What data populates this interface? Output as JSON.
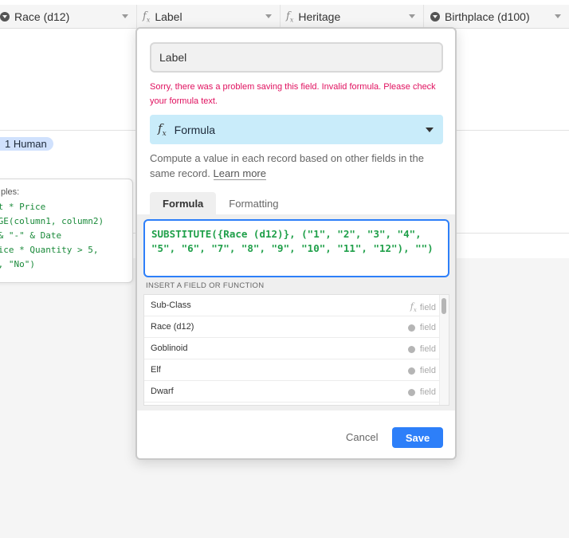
{
  "columns": [
    {
      "label": "Race (d12)",
      "icon": "single-select-icon"
    },
    {
      "label": "Label",
      "icon": "formula-icon"
    },
    {
      "label": "Heritage",
      "icon": "formula-icon"
    },
    {
      "label": "Birthplace (d100)",
      "icon": "single-select-icon"
    }
  ],
  "grid": {
    "tag": "1 Human",
    "examples_title": "ples:",
    "examples_lines": [
      "nt * Price",
      "AGE(column1, column2)",
      " & \"-\" & Date",
      "rice * Quantity > 5,",
      "\", \"No\")"
    ]
  },
  "dialog": {
    "field_name": "Label",
    "error": "Sorry, there was a problem saving this field. Invalid formula. Please check your formula text.",
    "type_label": "Formula",
    "description": "Compute a value in each record based on other fields in the same record.",
    "learn_more": "Learn more",
    "tabs": [
      "Formula",
      "Formatting"
    ],
    "formula": "SUBSTITUTE({Race (d12)}, (\"1\", \"2\", \"3\", \"4\", \"5\", \"6\", \"7\", \"8\", \"9\", \"10\", \"11\", \"12\"), \"\")",
    "insert_label": "INSERT A FIELD OR FUNCTION",
    "fields": [
      {
        "name": "Sub-Class",
        "kind": "field",
        "icon": "formula-icon"
      },
      {
        "name": "Race (d12)",
        "kind": "field",
        "icon": "single-select-icon"
      },
      {
        "name": "Goblinoid",
        "kind": "field",
        "icon": "single-select-icon"
      },
      {
        "name": "Elf",
        "kind": "field",
        "icon": "single-select-icon"
      },
      {
        "name": "Dwarf",
        "kind": "field",
        "icon": "single-select-icon"
      }
    ],
    "cancel": "Cancel",
    "save": "Save"
  },
  "colors": {
    "accent": "#2d7ff9",
    "error": "#e0115f",
    "formula_text": "#20a04a",
    "type_bg": "#c9ecfa"
  }
}
